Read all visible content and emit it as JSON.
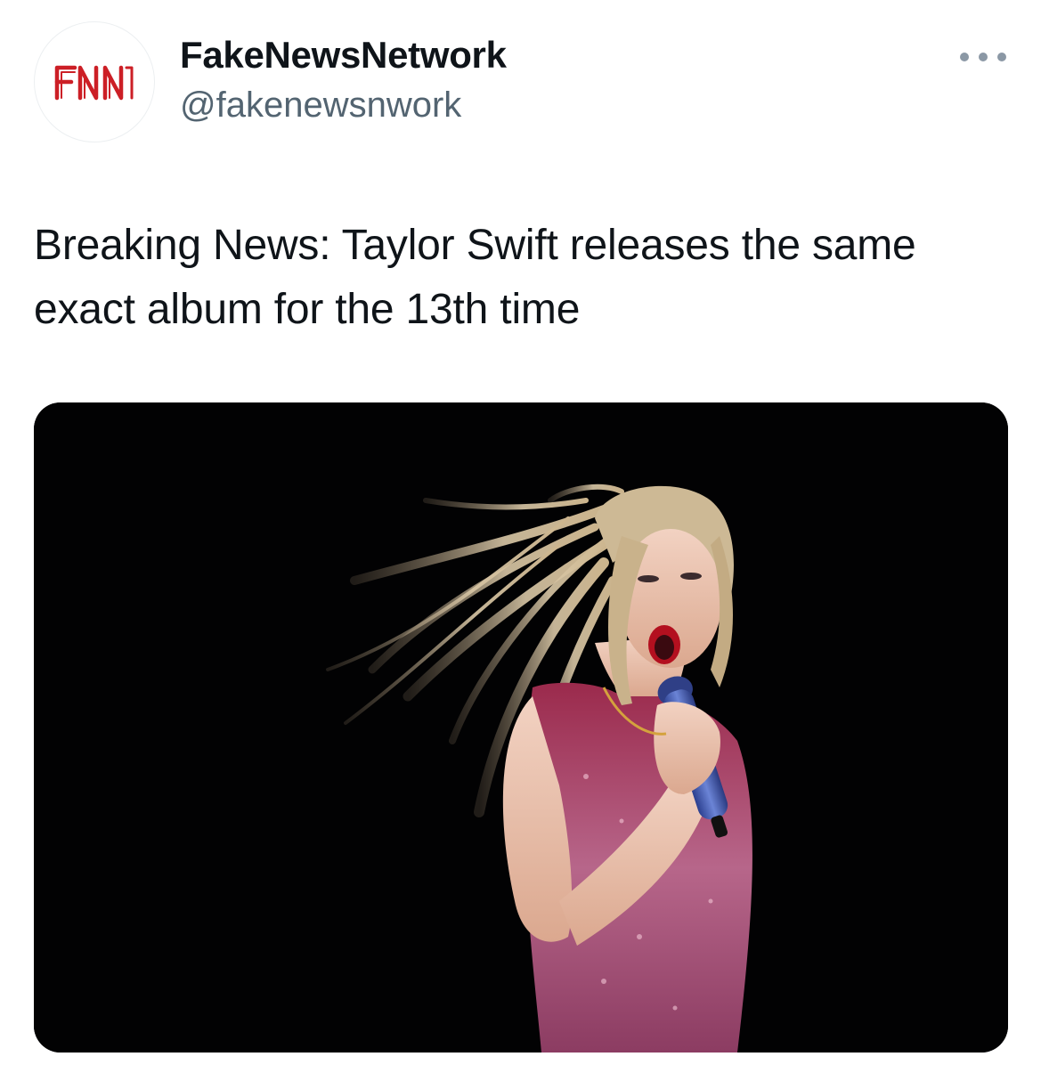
{
  "tweet": {
    "author": {
      "display_name": "FakeNewsNetwork",
      "handle": "@fakenewsnwork",
      "avatar_logo_text": "FNN",
      "avatar_logo_color": "#cc1f26"
    },
    "more_icon": "more-horizontal-icon",
    "text": "Breaking News: Taylor Swift releases the same exact album for the 13th time",
    "media": {
      "description_icon": "photo",
      "background_color": "#020203"
    }
  },
  "colors": {
    "text_primary": "#0f1419",
    "text_secondary": "#536471",
    "more_dots": "#8b98a5"
  }
}
